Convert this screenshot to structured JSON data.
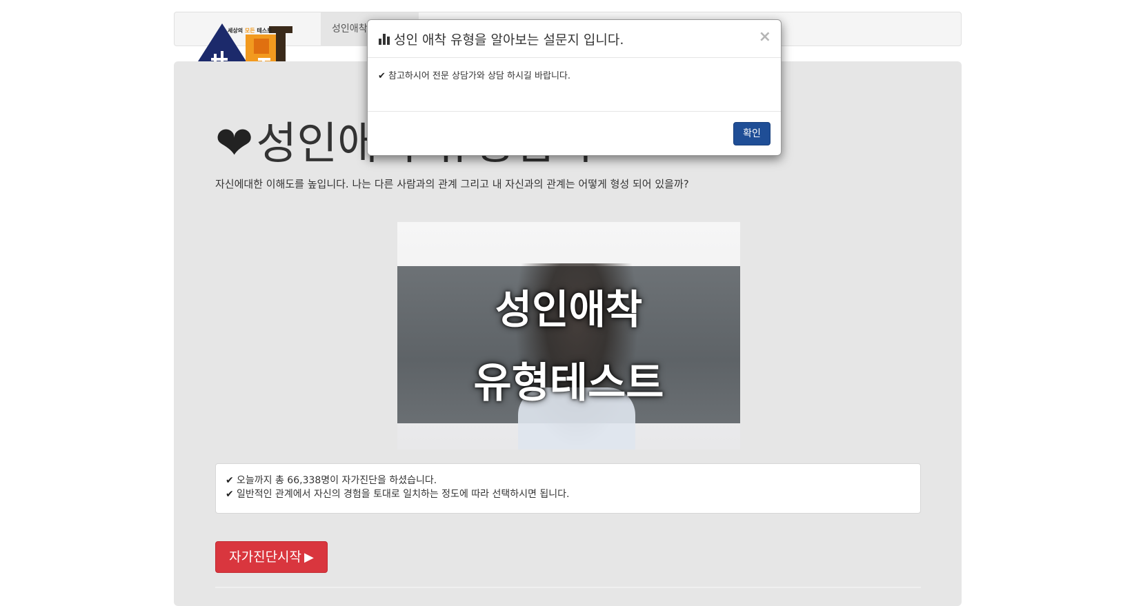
{
  "navbar": {
    "tab_label": "성인애착"
  },
  "logo": {
    "tagline_prefix": "세상의",
    "tagline_highlight": "모든",
    "tagline_suffix": "테스트"
  },
  "hero": {
    "title": "성인애착 유형검사",
    "subtitle": "자신에대한 이해도를 높입니다. 나는 다른 사람과의 관계 그리고 내 자신과의 관계는 어떻게 형성 되어 있을까?",
    "image_line1": "성인애착",
    "image_line2": "유형테스트"
  },
  "info": {
    "line1": "오늘까지 총 66,338명이 자가진단을 하셨습니다.",
    "line2": "일반적인 관계에서 자신의 경험을 토대로 일치하는 정도에 따라 선택하시면 됩니다."
  },
  "start_button": {
    "label": "자가진단시작"
  },
  "modal": {
    "title": "성인 애착 유형을 알아보는 설문지 입니다.",
    "close_glyph": "×",
    "body": "참고하시어 전문 상담가와 상담 하시길 바랍니다.",
    "ok_label": "확인"
  },
  "colors": {
    "accent_red": "#d9363e",
    "modal_button_blue": "#1f4e96",
    "logo_navy": "#1c2a6b",
    "logo_orange": "#f29a1f"
  },
  "icons": [
    "heart-icon",
    "check-icon",
    "play-icon",
    "bar-chart-icon",
    "close-icon"
  ]
}
